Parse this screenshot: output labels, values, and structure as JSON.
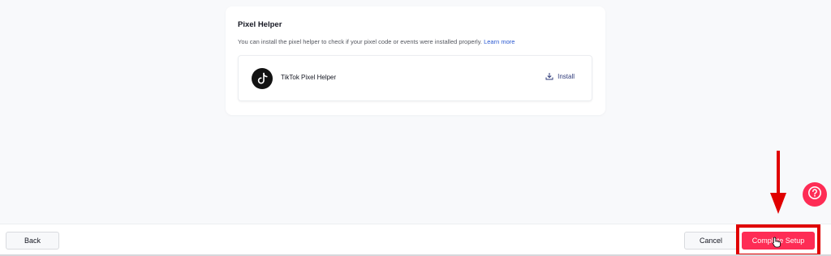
{
  "pixel_helper": {
    "title": "Pixel Helper",
    "description": "You can install the pixel helper to check if your pixel code or events were installed properly.",
    "learn_more": "Learn more",
    "helper_name": "TikTok Pixel Helper",
    "install_label": "Install",
    "logo_icon": "tiktok-logo-icon"
  },
  "help": {
    "icon": "question-circle-icon"
  },
  "footer": {
    "back_label": "Back",
    "cancel_label": "Cancel",
    "complete_label": "Complete Setup"
  },
  "colors": {
    "accent": "#fe2c55",
    "highlight": "#e00000",
    "link": "#2a59d1"
  }
}
